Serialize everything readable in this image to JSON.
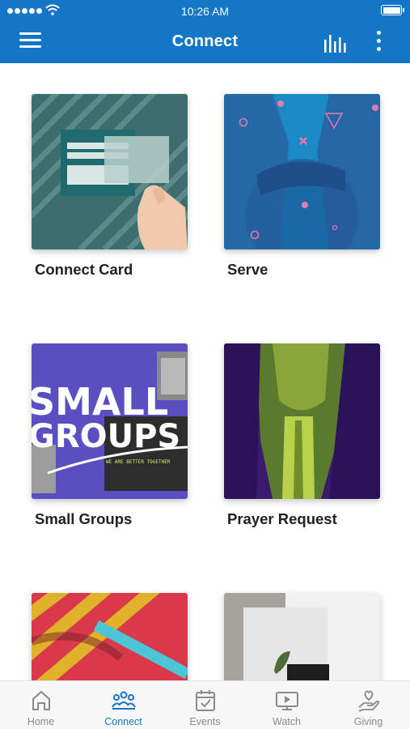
{
  "status_bar": {
    "time": "10:26 AM",
    "battery_level": 1.0
  },
  "header": {
    "title": "Connect",
    "menu_icon": "hamburger-icon",
    "stats_icon": "bar-chart-icon",
    "more_icon": "more-vertical-icon"
  },
  "colors": {
    "primary": "#1476c7",
    "inactive": "#8a8a8a",
    "card_text": "#222222"
  },
  "cards": [
    {
      "label": "Connect Card"
    },
    {
      "label": "Serve"
    },
    {
      "label": "Small Groups",
      "image_text": [
        "SMALL",
        "GROUPS",
        "WE ARE BETTER TOGETHER"
      ]
    },
    {
      "label": "Prayer Request"
    },
    {
      "label": ""
    },
    {
      "label": ""
    }
  ],
  "bottom_nav": {
    "active": "Connect",
    "tabs": [
      {
        "label": "Home",
        "icon": "home-icon"
      },
      {
        "label": "Connect",
        "icon": "people-icon"
      },
      {
        "label": "Events",
        "icon": "calendar-icon"
      },
      {
        "label": "Watch",
        "icon": "tv-play-icon"
      },
      {
        "label": "Giving",
        "icon": "heart-hand-icon"
      }
    ]
  }
}
